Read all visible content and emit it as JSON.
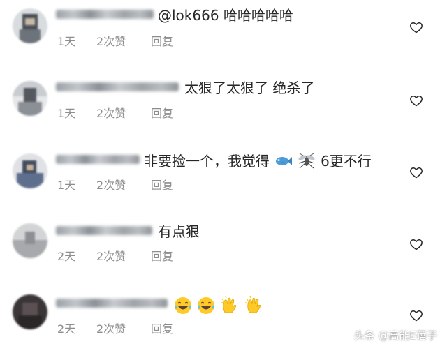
{
  "comments": [
    {
      "text": "@lok666 哈哈哈哈哈",
      "time": "1天",
      "likes": "2次赞",
      "reply": "回复",
      "like_icon": "heart-outline-icon"
    },
    {
      "text": "太狠了太狠了 绝杀了",
      "time": "1天",
      "likes": "2次赞",
      "reply": "回复",
      "like_icon": "heart-outline-icon"
    },
    {
      "text_before": "非要捡一个，我觉得",
      "emoji_1": "fish-emoji-icon",
      "emoji_2": "mosquito-emoji-icon",
      "text_after": "6更不行",
      "time": "1天",
      "likes": "2次赞",
      "reply": "回复",
      "like_icon": "heart-outline-icon"
    },
    {
      "text": "有点狠",
      "time": "2天",
      "likes": "2次赞",
      "reply": "回复",
      "like_icon": "heart-outline-icon"
    },
    {
      "emojis": [
        "laughing-tears-emoji-icon",
        "laughing-tears-emoji-icon",
        "clapping-hands-emoji-icon",
        "clapping-hands-emoji-icon"
      ],
      "time": "2天",
      "likes": "2次赞",
      "reply": "回复",
      "like_icon": "heart-outline-icon"
    }
  ],
  "watermark": "头条 @高能E蓓子",
  "colors": {
    "text": "#262626",
    "meta": "#8e8e8e",
    "icon": "#262626"
  }
}
